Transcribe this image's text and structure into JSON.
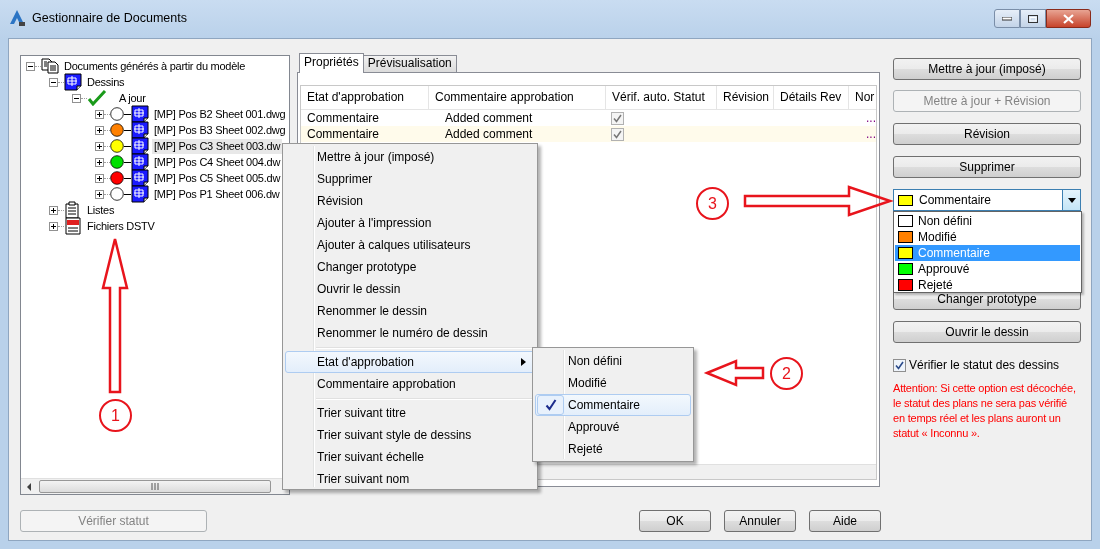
{
  "window": {
    "title": "Gestionnaire de Documents"
  },
  "tree": {
    "items": [
      {
        "label": "Documents générés à partir du modèle",
        "kind": "document",
        "expanded": true,
        "children": [
          {
            "label": "Dessins",
            "kind": "drawings",
            "expanded": true,
            "children": [
              {
                "label": "A jour",
                "kind": "status",
                "expanded": true,
                "children": [
                  {
                    "label": "[MP] Pos B2 Sheet 001.dwg",
                    "kind": "drawing",
                    "color": "#ffffff",
                    "expanded": false,
                    "selected": false
                  },
                  {
                    "label": "[MP] Pos B3 Sheet 002.dwg",
                    "kind": "drawing",
                    "color": "#ff8000",
                    "expanded": false,
                    "selected": false
                  },
                  {
                    "label": "[MP] Pos C3 Sheet 003.dw",
                    "kind": "drawing",
                    "color": "#ffff00",
                    "expanded": false,
                    "selected": true
                  },
                  {
                    "label": "[MP] Pos C4 Sheet 004.dw",
                    "kind": "drawing",
                    "color": "#00e000",
                    "expanded": false,
                    "selected": false
                  },
                  {
                    "label": "[MP] Pos C5 Sheet 005.dw",
                    "kind": "drawing",
                    "color": "#ff0000",
                    "expanded": false,
                    "selected": false
                  },
                  {
                    "label": "[MP] Pos P1 Sheet 006.dw",
                    "kind": "drawing",
                    "color": "#ffffff",
                    "expanded": false,
                    "selected": false
                  }
                ]
              }
            ]
          },
          {
            "label": "Listes",
            "kind": "list",
            "expanded": false
          },
          {
            "label": "Fichiers DSTV",
            "kind": "dstv",
            "expanded": false
          }
        ]
      }
    ]
  },
  "tabs": [
    {
      "label": "Propriétés",
      "selected": true
    },
    {
      "label": "Prévisualisation",
      "selected": false
    }
  ],
  "table": {
    "columns": [
      "Etat d'approbation",
      "Commentaire approbation",
      "Vérif. auto. Statut",
      "Révision",
      "Détails Rev",
      "Nor"
    ],
    "rows": [
      {
        "approval_state": "Commentaire",
        "approval_comment": "Added comment",
        "auto_check": true,
        "column_6": "..."
      },
      {
        "approval_state": "Commentaire",
        "approval_comment": "Added comment",
        "auto_check": true,
        "column_6": "..."
      }
    ]
  },
  "side_buttons": [
    {
      "label": "Mettre à jour (imposé)",
      "disabled": false
    },
    {
      "label": "Mettre à jour + Révision",
      "disabled": true
    },
    {
      "label": "Révision",
      "disabled": false
    },
    {
      "label": "Supprimer",
      "disabled": false
    }
  ],
  "status_combo": {
    "value": "Commentaire",
    "color": "#ffff00"
  },
  "lower_buttons": [
    {
      "label": "Changer prototype",
      "disabled": false
    },
    {
      "label": "Ouvrir le dessin",
      "disabled": false
    }
  ],
  "verify_checkbox": {
    "label": "Vérifier le statut des dessins",
    "checked": true
  },
  "warning": "Attention: Si cette option est décochée, le statut des plans ne sera pas vérifié en temps réel et les plans auront un statut « Inconnu ».",
  "verify_button": {
    "label": "Vérifier statut",
    "disabled": true
  },
  "dialog_buttons": [
    {
      "label": "OK",
      "disabled": false
    },
    {
      "label": "Annuler",
      "disabled": false
    },
    {
      "label": "Aide",
      "disabled": false
    }
  ],
  "context_menu": {
    "items": [
      {
        "kind": "item",
        "label": "Mettre à jour (imposé)",
        "selected": false
      },
      {
        "kind": "item",
        "label": "Supprimer",
        "selected": false
      },
      {
        "kind": "item",
        "label": "Révision",
        "selected": false
      },
      {
        "kind": "item",
        "label": "Ajouter à l'impression",
        "selected": false
      },
      {
        "kind": "item",
        "label": "Ajouter à calques utilisateurs",
        "selected": false
      },
      {
        "kind": "item",
        "label": "Changer prototype",
        "selected": false
      },
      {
        "kind": "item",
        "label": "Ouvrir le dessin",
        "selected": false
      },
      {
        "kind": "item",
        "label": "Renommer le dessin",
        "selected": false
      },
      {
        "kind": "item",
        "label": "Renommer le numéro de dessin",
        "selected": false
      },
      {
        "kind": "separator"
      },
      {
        "kind": "submenu",
        "label": "Etat d'approbation",
        "selected": true
      },
      {
        "kind": "item",
        "label": "Commentaire approbation",
        "selected": false
      },
      {
        "kind": "separator"
      },
      {
        "kind": "item",
        "label": "Trier suivant titre",
        "selected": false
      },
      {
        "kind": "item",
        "label": "Trier suivant style de dessins",
        "selected": false
      },
      {
        "kind": "item",
        "label": "Trier suivant échelle",
        "selected": false
      },
      {
        "kind": "item",
        "label": "Trier suivant nom",
        "selected": false
      }
    ]
  },
  "submenu": {
    "items": [
      {
        "label": "Non défini",
        "checked": false,
        "selected": false
      },
      {
        "label": "Modifié",
        "checked": false,
        "selected": false
      },
      {
        "label": "Commentaire",
        "checked": true,
        "selected": true
      },
      {
        "label": "Approuvé",
        "checked": false,
        "selected": false
      },
      {
        "label": "Rejeté",
        "checked": false,
        "selected": false
      }
    ]
  },
  "status_dropdown": {
    "options": [
      {
        "label": "Non défini",
        "color": "#ffffff",
        "selected": false
      },
      {
        "label": "Modifié",
        "color": "#ff8000",
        "selected": false
      },
      {
        "label": "Commentaire",
        "color": "#ffff00",
        "selected": true
      },
      {
        "label": "Approuvé",
        "color": "#00ff00",
        "selected": false
      },
      {
        "label": "Rejeté",
        "color": "#ff0000",
        "selected": false
      }
    ]
  },
  "annotations": [
    {
      "label": "1"
    },
    {
      "label": "2"
    },
    {
      "label": "3"
    }
  ]
}
